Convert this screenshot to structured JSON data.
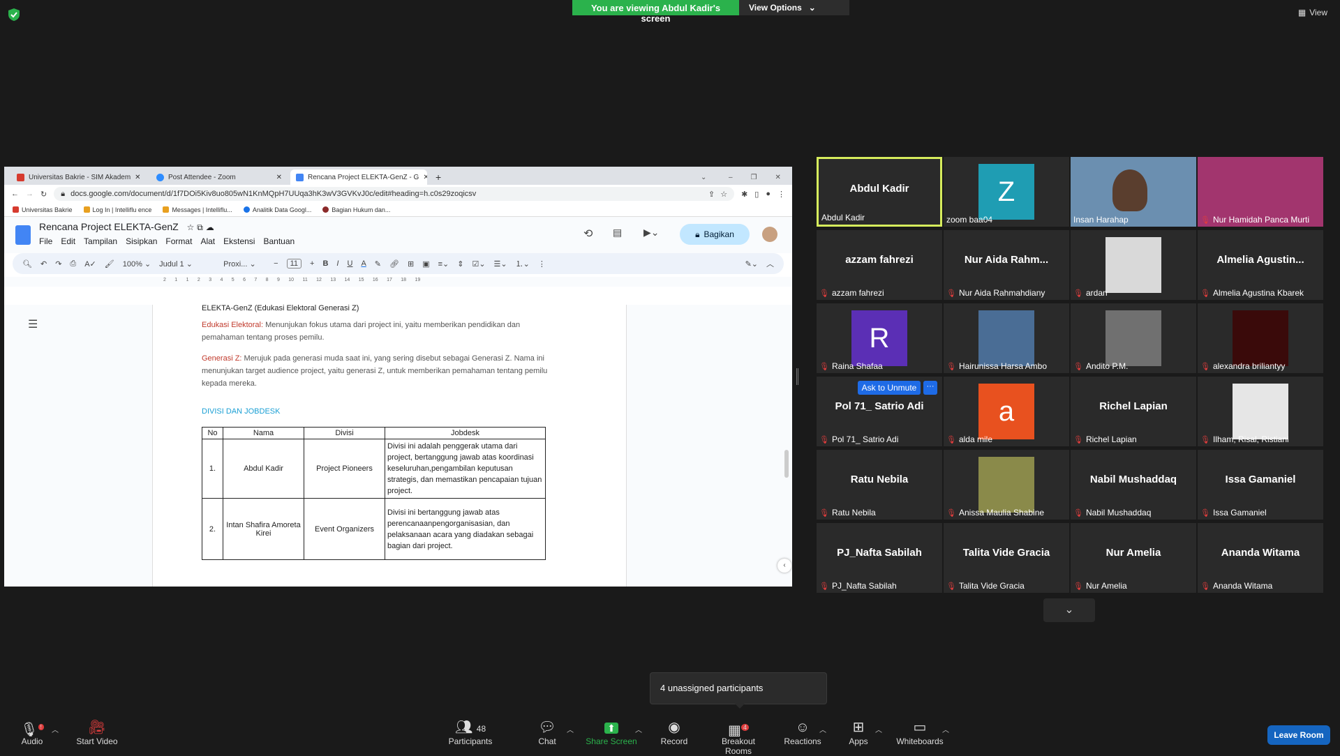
{
  "banner": {
    "viewing": "You are viewing Abdul Kadir's screen",
    "view_options": "View Options"
  },
  "view_label": "View",
  "browser": {
    "tabs": [
      {
        "label": "Universitas Bakrie - SIM Akadem",
        "color": "#d63b2f"
      },
      {
        "label": "Post Attendee - Zoom",
        "color": "#2d8cff"
      },
      {
        "label": "Rencana Project ELEKTA-GenZ - G",
        "color": "#4285f4"
      }
    ],
    "url": "docs.google.com/document/d/1f7DOi5Kiv8uo805wN1KnMQpH7UUqa3hK3wV3GVKvJ0c/edit#heading=h.c0s29zoqicsv",
    "bookmarks": [
      "Universitas Bakrie",
      "Log In | Intelliflu ence",
      "Messages | Intelliflu...",
      "Analitik Data Googl...",
      "Bagian Hukum dan..."
    ]
  },
  "doc": {
    "title": "Rencana Project ELEKTA-GenZ",
    "menus": [
      "File",
      "Edit",
      "Tampilan",
      "Sisipkan",
      "Format",
      "Alat",
      "Ekstensi",
      "Bantuan"
    ],
    "share_label": "Bagikan",
    "zoom": "100%",
    "style": "Judul 1",
    "font": "Proxi...",
    "font_size": "11",
    "ruler": [
      "2",
      "1",
      "1",
      "2",
      "3",
      "4",
      "5",
      "6",
      "7",
      "8",
      "9",
      "10",
      "11",
      "12",
      "13",
      "14",
      "15",
      "16",
      "17",
      "18",
      "19"
    ],
    "top_line": "ELEKTA-GenZ (Edukasi Elektoral Generasi Z)",
    "p1_label": "Edukasi Elektoral:",
    "p1_text": " Menunjukan fokus utama dari project ini, yaitu memberikan pendidikan dan pemahaman tentang proses pemilu.",
    "p2_label": "Generasi Z:",
    "p2_text": " Merujuk pada generasi muda saat ini, yang sering disebut sebagai Generasi Z. Nama ini menunjukan target audience project, yaitu generasi Z, untuk memberikan pemahaman tentang pemilu kepada mereka.",
    "section_heading": "DIVISI DAN JOBDESK",
    "table_headers": [
      "No",
      "Nama",
      "Divisi",
      "Jobdesk"
    ],
    "rows": [
      {
        "no": "1.",
        "nama": "Abdul Kadir",
        "divisi": "Project Pioneers",
        "jobdesk": "Divisi ini adalah penggerak utama dari project, bertanggung jawab atas koordinasi keseluruhan,pengambilan keputusan strategis, dan memastikan pencapaian tujuan project."
      },
      {
        "no": "2.",
        "nama": "Intan Shafira Amoreta Kirei",
        "divisi": "Event Organizers",
        "jobdesk": "Divisi ini bertanggung jawab atas perencanaanpengorganisasian, dan pelaksanaan acara yang diadakan sebagai bagian dari project."
      }
    ]
  },
  "participants": [
    {
      "name": "Abdul Kadir",
      "label": "Abdul Kadir",
      "muted": false,
      "avatar": "none",
      "active": true
    },
    {
      "name": "",
      "label": "zoom baa04",
      "muted": false,
      "avatar": "letter",
      "letter": "Z",
      "color": "#1f9db3"
    },
    {
      "name": "",
      "label": "Insan Harahap",
      "muted": false,
      "avatar": "video",
      "color": "#6b8fb0"
    },
    {
      "name": "",
      "label": "Nur Hamidah Panca Murti",
      "muted": true,
      "avatar": "photo",
      "color": "#a2356e"
    },
    {
      "name": "azzam fahrezi",
      "label": "azzam fahrezi",
      "muted": true,
      "avatar": "none"
    },
    {
      "name": "Nur Aida Rahm...",
      "label": "Nur Aida Rahmahdiany",
      "muted": true,
      "avatar": "none"
    },
    {
      "name": "",
      "label": "ardan",
      "muted": true,
      "avatar": "photo",
      "color": "#d9d9d9"
    },
    {
      "name": "Almelia Agustin...",
      "label": "Almelia Agustina Kbarek",
      "muted": true,
      "avatar": "none"
    },
    {
      "name": "",
      "label": "Raina Shafaa",
      "muted": true,
      "avatar": "letter",
      "letter": "R",
      "color": "#5b2fb5"
    },
    {
      "name": "",
      "label": "Hairunissa Harsa Ambo",
      "muted": true,
      "avatar": "photo",
      "color": "#4a6d95"
    },
    {
      "name": "",
      "label": "Andito P.M.",
      "muted": true,
      "avatar": "photo",
      "color": "#707070"
    },
    {
      "name": "",
      "label": "alexandra briliantyy",
      "muted": true,
      "avatar": "photo",
      "color": "#3a0a0a"
    },
    {
      "name": "Pol 71_ Satrio Adi",
      "label": "Pol 71_ Satrio Adi",
      "muted": true,
      "avatar": "none"
    },
    {
      "name": "",
      "label": "alda mile",
      "muted": true,
      "avatar": "letter",
      "letter": "a",
      "color": "#e8511f"
    },
    {
      "name": "Richel Lapian",
      "label": "Richel Lapian",
      "muted": true,
      "avatar": "none"
    },
    {
      "name": "",
      "label": "Ilham, Risal, Ristiani",
      "muted": true,
      "avatar": "photo",
      "color": "#e6e6e6"
    },
    {
      "name": "Ratu Nebila",
      "label": "Ratu Nebila",
      "muted": true,
      "avatar": "none"
    },
    {
      "name": "",
      "label": "Anissa Maulia Shabine",
      "muted": true,
      "avatar": "photo",
      "color": "#8a8a4a"
    },
    {
      "name": "Nabil Mushaddaq",
      "label": "Nabil Mushaddaq",
      "muted": true,
      "avatar": "none"
    },
    {
      "name": "Issa Gamaniel",
      "label": "Issa Gamaniel",
      "muted": true,
      "avatar": "none"
    },
    {
      "name": "PJ_Nafta Sabilah",
      "label": "PJ_Nafta Sabilah",
      "muted": true,
      "avatar": "none"
    },
    {
      "name": "Talita Vide Gracia",
      "label": "Talita Vide Gracia",
      "muted": true,
      "avatar": "none"
    },
    {
      "name": "Nur Amelia",
      "label": "Nur Amelia",
      "muted": true,
      "avatar": "none"
    },
    {
      "name": "Ananda Witama",
      "label": "Ananda Witama",
      "muted": true,
      "avatar": "none"
    }
  ],
  "ask_unmute": "Ask to Unmute",
  "more_label": "···",
  "toast": "4 unassigned participants",
  "bottom": {
    "audio": "Audio",
    "start_video": "Start Video",
    "participants": "Participants",
    "participants_count": "48",
    "chat": "Chat",
    "share_screen": "Share Screen",
    "record": "Record",
    "breakout": "Breakout Rooms",
    "breakout_badge": "4",
    "reactions": "Reactions",
    "apps": "Apps",
    "whiteboards": "Whiteboards",
    "leave": "Leave Room"
  },
  "colors": {
    "accent_green": "#2bb24c",
    "active_border": "#d6ec5c",
    "leave": "#1565c0",
    "muted_red": "#e03d3d"
  }
}
